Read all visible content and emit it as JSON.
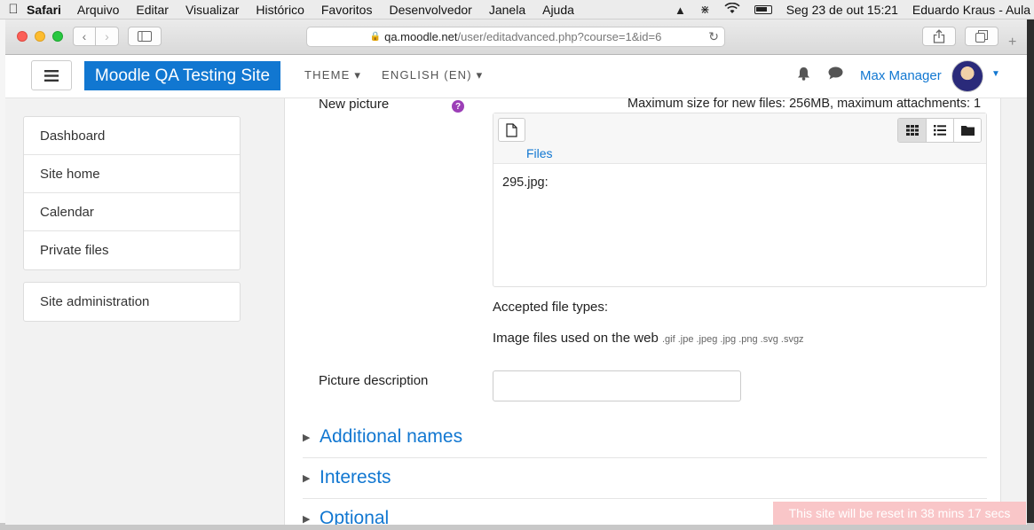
{
  "menubar": {
    "app_name": "Safari",
    "items": [
      "Arquivo",
      "Editar",
      "Visualizar",
      "Histórico",
      "Favoritos",
      "Desenvolvedor",
      "Janela",
      "Ajuda"
    ],
    "datetime": "Seg 23 de out  15:21",
    "user": "Eduardo Kraus - Aula"
  },
  "browser": {
    "url_host": "qa.moodle.net",
    "url_path": "/user/editadvanced.php?course=1&id=6"
  },
  "navbar": {
    "brand": "Moodle QA Testing Site",
    "theme_menu": "THEME",
    "language_menu": "ENGLISH (EN)",
    "user_name": "Max Manager"
  },
  "drawer": {
    "items": [
      "Dashboard",
      "Site home",
      "Calendar",
      "Private files"
    ],
    "admin_item": "Site administration"
  },
  "form": {
    "new_picture_label": "New picture",
    "help_icon_text": "?",
    "max_size_text": "Maximum size for new files: 256MB, maximum attachments: 1",
    "filepicker_path": "Files",
    "file_name": "295.jpg:",
    "accepted_label": "Accepted file types:",
    "accepted_desc": "Image files used on the web",
    "accepted_exts": ".gif .jpe .jpeg .jpg .png .svg .svgz",
    "picture_description_label": "Picture description",
    "picture_description_value": "",
    "sections": [
      "Additional names",
      "Interests",
      "Optional"
    ]
  },
  "banner": {
    "reset_text": "This site will be reset in 38 mins 17 secs"
  },
  "colors": {
    "brand": "#1177d1",
    "help": "#9c3fb7",
    "banner": "#f9c6c8"
  }
}
